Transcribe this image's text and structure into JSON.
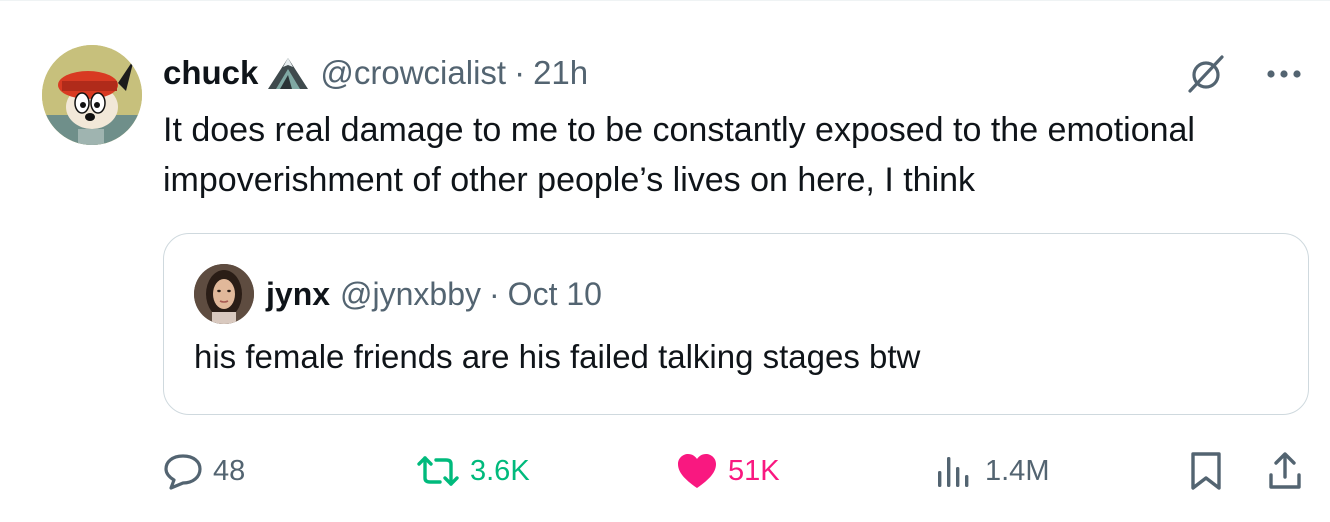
{
  "tweet": {
    "author": {
      "display_name": "chuck",
      "handle": "@crowcialist",
      "separator": "·",
      "time": "21h"
    },
    "text": "It does real damage to me to be constantly exposed to the emotional impoverishment of other people’s lives on here, I think",
    "quote": {
      "display_name": "jynx",
      "handle": "@jynxbby",
      "separator": "·",
      "date": "Oct 10",
      "text": "his female friends are his failed talking stages btw"
    },
    "stats": {
      "replies": "48",
      "reposts": "3.6K",
      "likes": "51K",
      "views": "1.4M"
    },
    "icons": {
      "grok": "grok-icon",
      "more": "more-icon",
      "reply": "reply-icon",
      "repost": "repost-icon",
      "like": "heart-icon",
      "views": "views-icon",
      "bookmark": "bookmark-icon",
      "share": "share-icon"
    },
    "colors": {
      "text": "#0f1419",
      "secondary": "#536471",
      "repost_active": "#00ba7c",
      "like_active": "#f91880",
      "border": "#cfd9de"
    }
  }
}
